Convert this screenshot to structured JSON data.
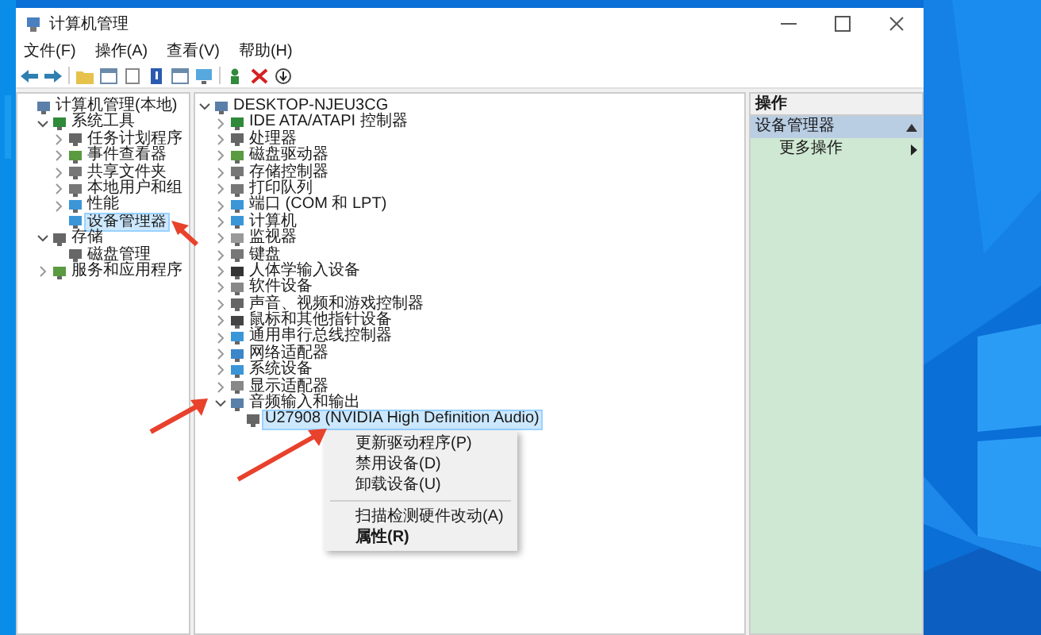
{
  "window": {
    "title": "计算机管理",
    "menu": [
      "文件(F)",
      "操作(A)",
      "查看(V)",
      "帮助(H)"
    ]
  },
  "navigation_tree": [
    {
      "label": "计算机管理(本地)",
      "selected": false,
      "children": [
        {
          "label": "系统工具",
          "expanded": true,
          "selected": false,
          "children": [
            {
              "label": "任务计划程序",
              "expanded": false,
              "selected": false
            },
            {
              "label": "事件查看器",
              "expanded": false,
              "selected": false
            },
            {
              "label": "共享文件夹",
              "expanded": false,
              "selected": false
            },
            {
              "label": "本地用户和组",
              "expanded": false,
              "selected": false
            },
            {
              "label": "性能",
              "expanded": false,
              "selected": false
            },
            {
              "label": "设备管理器",
              "selected": true
            }
          ]
        },
        {
          "label": "存储",
          "expanded": true,
          "selected": false,
          "children": [
            {
              "label": "磁盘管理",
              "selected": false
            }
          ]
        },
        {
          "label": "服务和应用程序",
          "expanded": false,
          "selected": false
        }
      ]
    }
  ],
  "device_tree": [
    {
      "label": "DESKTOP-NJEU3CG",
      "expanded": true,
      "selected": false,
      "children": [
        {
          "label": "IDE ATA/ATAPI 控制器",
          "expanded": false,
          "selected": false
        },
        {
          "label": "处理器",
          "expanded": false,
          "selected": false
        },
        {
          "label": "磁盘驱动器",
          "expanded": false,
          "selected": false
        },
        {
          "label": "存储控制器",
          "expanded": false,
          "selected": false
        },
        {
          "label": "打印队列",
          "expanded": false,
          "selected": false
        },
        {
          "label": "端口 (COM 和 LPT)",
          "expanded": false,
          "selected": false
        },
        {
          "label": "计算机",
          "expanded": false,
          "selected": false
        },
        {
          "label": "监视器",
          "expanded": false,
          "selected": false
        },
        {
          "label": "键盘",
          "expanded": false,
          "selected": false
        },
        {
          "label": "人体学输入设备",
          "expanded": false,
          "selected": false
        },
        {
          "label": "软件设备",
          "expanded": false,
          "selected": false
        },
        {
          "label": "声音、视频和游戏控制器",
          "expanded": false,
          "selected": false
        },
        {
          "label": "鼠标和其他指针设备",
          "expanded": false,
          "selected": false
        },
        {
          "label": "通用串行总线控制器",
          "expanded": false,
          "selected": false
        },
        {
          "label": "网络适配器",
          "expanded": false,
          "selected": false
        },
        {
          "label": "系统设备",
          "expanded": false,
          "selected": false
        },
        {
          "label": "显示适配器",
          "expanded": false,
          "selected": false
        },
        {
          "label": "音频输入和输出",
          "expanded": true,
          "selected": false,
          "children": [
            {
              "label": "U27908 (NVIDIA High Definition Audio)",
              "selected": true
            }
          ]
        }
      ]
    }
  ],
  "context_menu": [
    {
      "kind": "item",
      "label": "更新驱动程序(P)"
    },
    {
      "kind": "item",
      "label": "禁用设备(D)"
    },
    {
      "kind": "item",
      "label": "卸载设备(U)"
    },
    {
      "kind": "separator"
    },
    {
      "kind": "item",
      "label": "扫描检测硬件改动(A)"
    },
    {
      "kind": "default",
      "label": "属性(R)"
    }
  ],
  "actions": {
    "header": "操作",
    "sections": [
      {
        "title": "设备管理器",
        "expanded": true,
        "items": [
          "更多操作"
        ]
      }
    ]
  }
}
